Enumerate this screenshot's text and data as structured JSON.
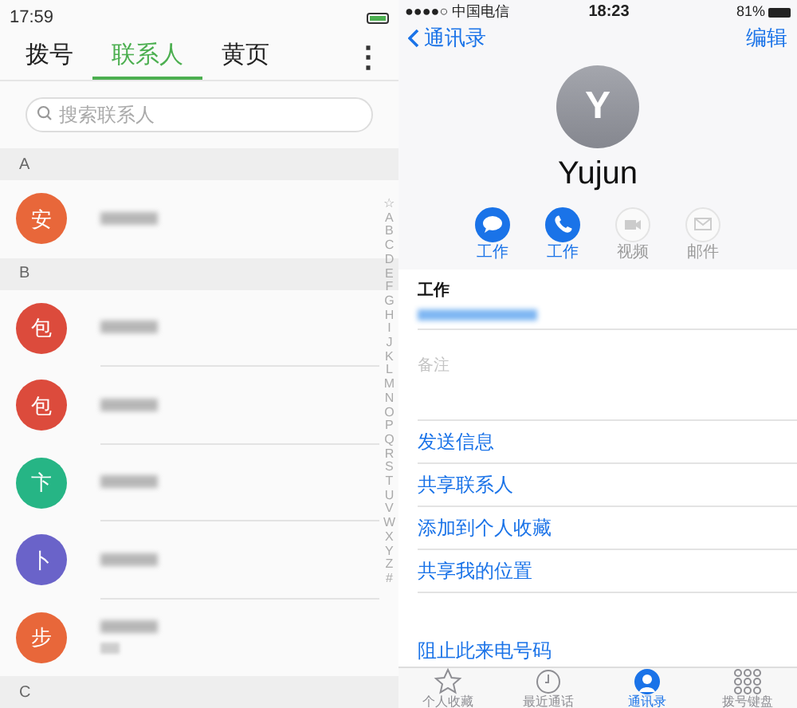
{
  "left": {
    "status_bar": {
      "time": "17:59"
    },
    "tabs": [
      {
        "label": "拨号",
        "selected": false
      },
      {
        "label": "联系人",
        "selected": true
      },
      {
        "label": "黄页",
        "selected": false
      }
    ],
    "menu_icon": "⋮",
    "search": {
      "placeholder": "搜索联系人"
    },
    "sections": [
      {
        "letter": "A",
        "contacts": [
          {
            "initial": "安",
            "color": "#e8673a",
            "has_detail": false
          }
        ]
      },
      {
        "letter": "B",
        "contacts": [
          {
            "initial": "包",
            "color": "#dc4b3c",
            "has_detail": false
          },
          {
            "initial": "包",
            "color": "#dc4b3c",
            "has_detail": false
          },
          {
            "initial": "卞",
            "color": "#26b585",
            "has_detail": false
          },
          {
            "initial": "卜",
            "color": "#6a63c9",
            "has_detail": false
          },
          {
            "initial": "步",
            "color": "#e8673a",
            "has_detail": true
          }
        ]
      },
      {
        "letter": "C"
      }
    ],
    "index": [
      "☆",
      "A",
      "B",
      "C",
      "D",
      "E",
      "F",
      "G",
      "H",
      "I",
      "J",
      "K",
      "L",
      "M",
      "N",
      "O",
      "P",
      "Q",
      "R",
      "S",
      "T",
      "U",
      "V",
      "W",
      "X",
      "Y",
      "Z",
      "#"
    ]
  },
  "right": {
    "status_bar": {
      "carrier": "●●●●○ 中国电信",
      "time": "18:23",
      "battery": "81%"
    },
    "nav": {
      "back": "通讯录",
      "edit": "编辑"
    },
    "avatar": "Y",
    "name": "Yujun",
    "actions": [
      {
        "kind": "message",
        "label": "工作",
        "disabled": false
      },
      {
        "kind": "phone",
        "label": "工作",
        "disabled": false
      },
      {
        "kind": "video",
        "label": "视频",
        "disabled": true
      },
      {
        "kind": "mail",
        "label": "邮件",
        "disabled": true
      }
    ],
    "email_label": "工作",
    "notes_placeholder": "备注",
    "links": [
      "发送信息",
      "共享联系人",
      "添加到个人收藏",
      "共享我的位置"
    ],
    "block": "阻止此来电号码",
    "tab_bar": [
      {
        "kind": "star",
        "label": "个人收藏",
        "selected": false
      },
      {
        "kind": "clock",
        "label": "最近通话",
        "selected": false
      },
      {
        "kind": "person",
        "label": "通讯录",
        "selected": true
      },
      {
        "kind": "keypad",
        "label": "拨号键盘",
        "selected": false
      }
    ]
  }
}
